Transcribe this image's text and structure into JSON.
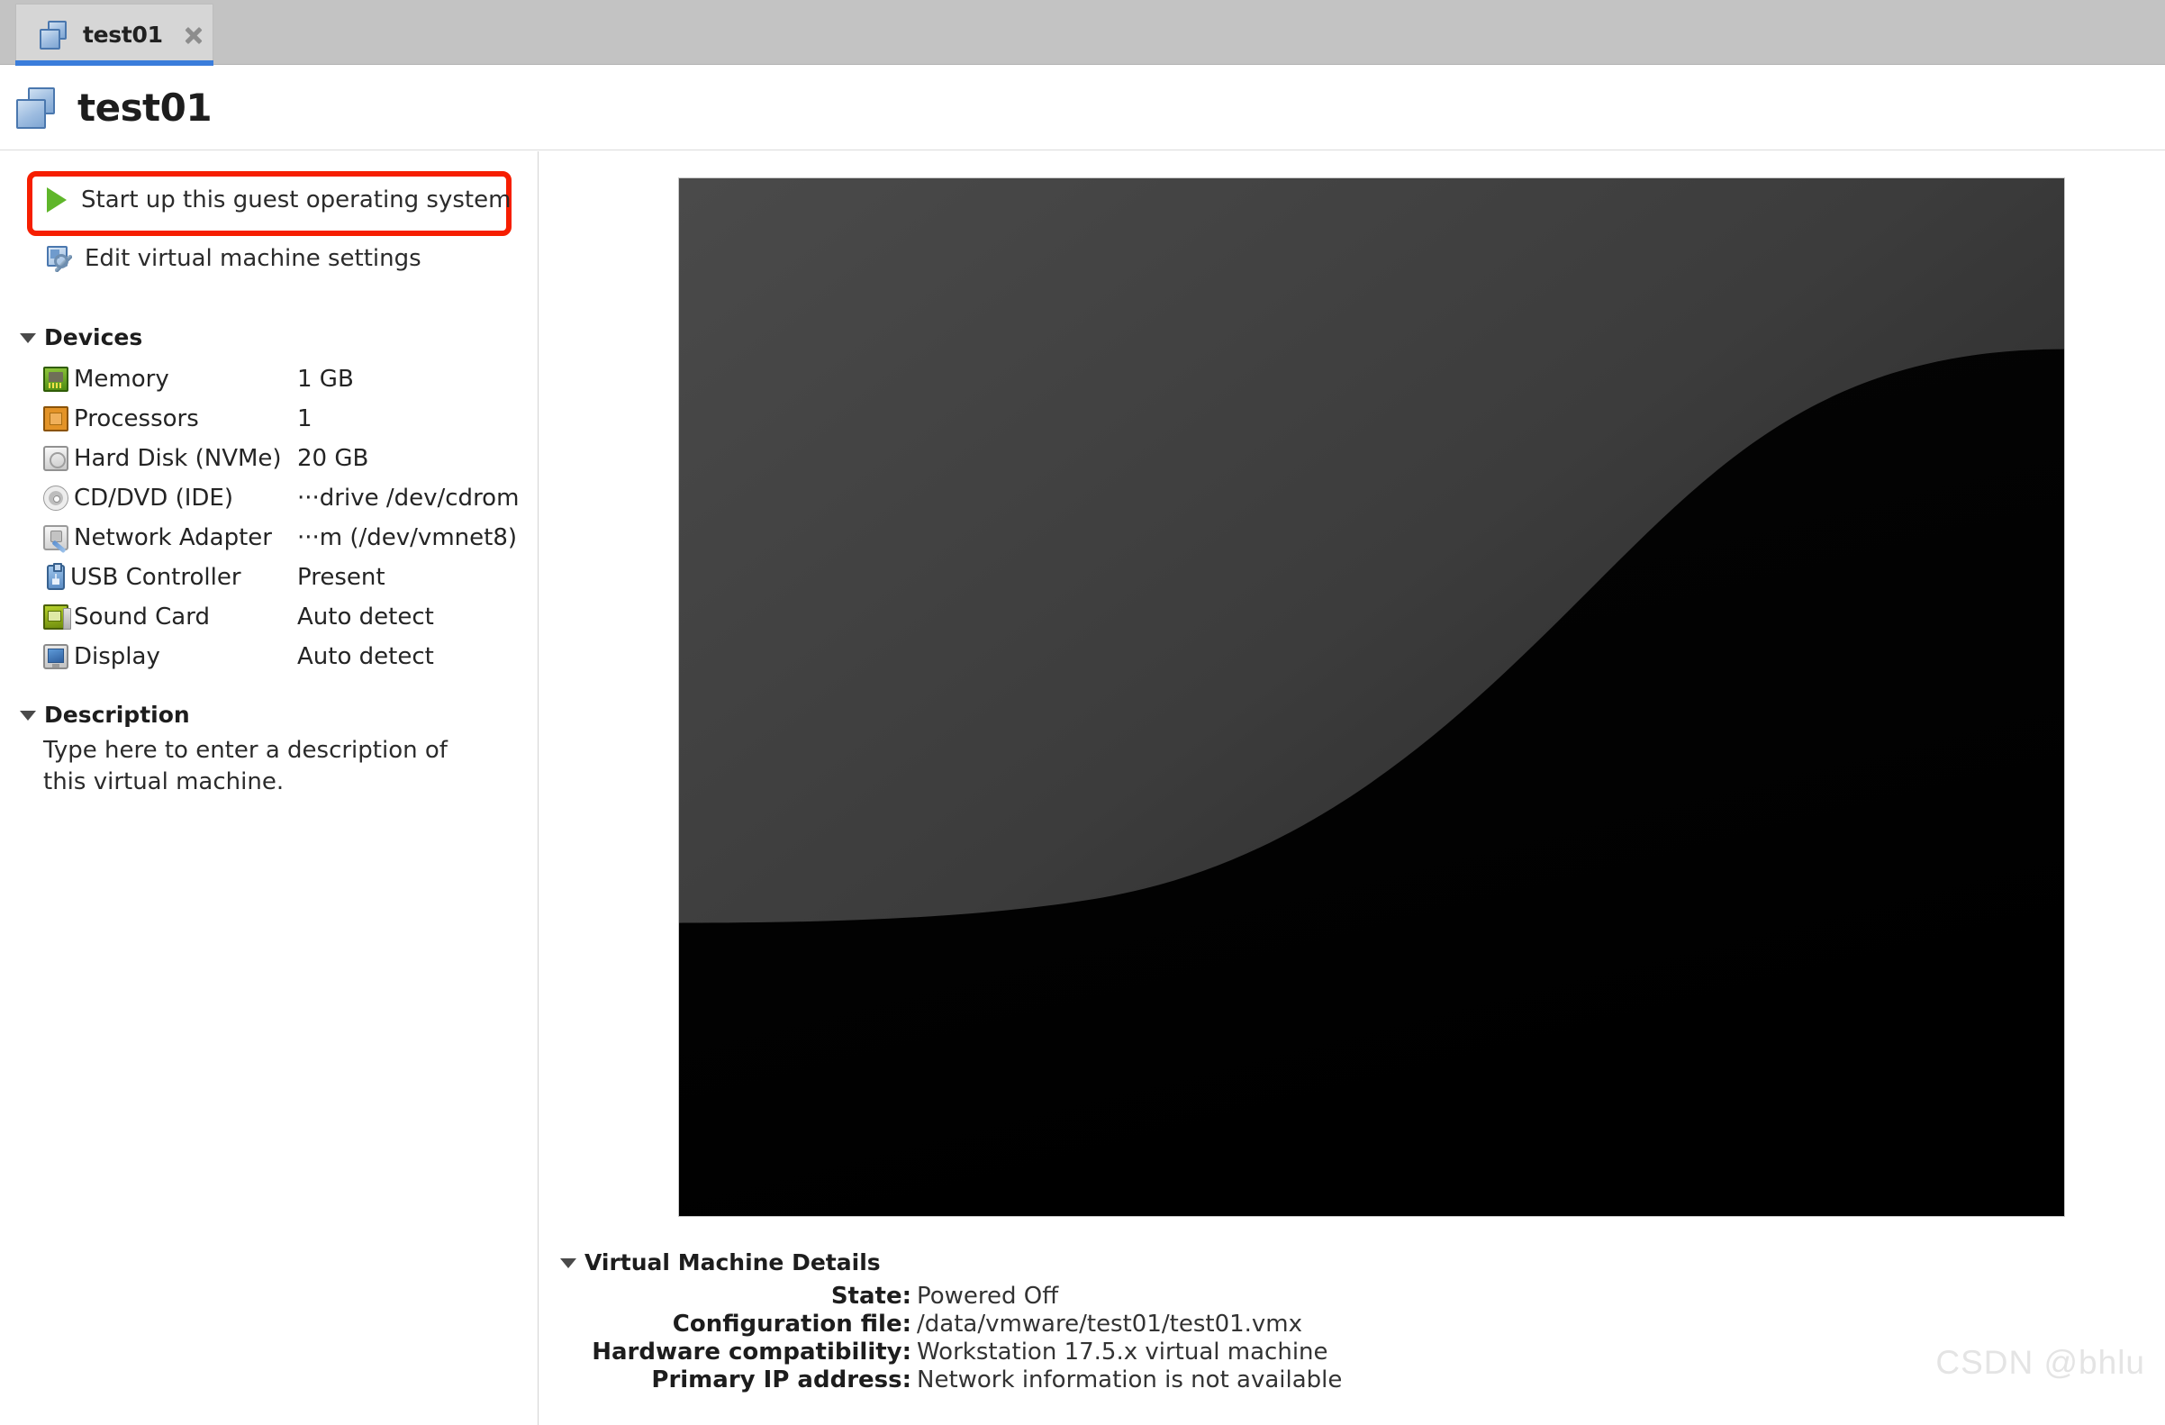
{
  "tab": {
    "label": "test01",
    "icon": "vm-stack-icon",
    "close_icon": "close-icon",
    "accent_color": "#3a7ddb",
    "bg_color": "#d6d6d6"
  },
  "header": {
    "title": "test01",
    "icon": "vm-stack-icon"
  },
  "sidebar": {
    "actions": [
      {
        "label": "Start up this guest operating system",
        "icon": "play-icon",
        "highlighted": true
      },
      {
        "label": "Edit virtual machine settings",
        "icon": "settings-icon",
        "highlighted": false
      }
    ],
    "highlight_color": "#f61e00",
    "devices_section": {
      "title": "Devices",
      "expanded": true,
      "rows": [
        {
          "name": "Memory",
          "value": "1 GB",
          "icon": "memory-chip-icon"
        },
        {
          "name": "Processors",
          "value": "1",
          "icon": "cpu-chip-icon"
        },
        {
          "name": "Hard Disk (NVMe)",
          "value": "20 GB",
          "icon": "hard-disk-icon"
        },
        {
          "name": "CD/DVD (IDE)",
          "value": "···drive /dev/cdrom",
          "icon": "cd-dvd-icon"
        },
        {
          "name": "Network Adapter",
          "value": "···m (/dev/vmnet8)",
          "icon": "network-adapter-icon"
        },
        {
          "name": "USB Controller",
          "value": "Present",
          "icon": "usb-icon"
        },
        {
          "name": "Sound Card",
          "value": "Auto detect",
          "icon": "sound-card-icon"
        },
        {
          "name": "Display",
          "value": "Auto detect",
          "icon": "display-icon"
        }
      ]
    },
    "description_section": {
      "title": "Description",
      "expanded": true,
      "placeholder": "Type here to enter a description of this virtual machine."
    }
  },
  "main": {
    "preview": {
      "name": "vm-screen-preview",
      "bg_top_color": "#414141",
      "bg_bottom_color": "#000000"
    },
    "details_section": {
      "title": "Virtual Machine Details",
      "expanded": true,
      "rows": [
        {
          "label": "State:",
          "value": "Powered Off"
        },
        {
          "label": "Configuration file:",
          "value": "/data/vmware/test01/test01.vmx"
        },
        {
          "label": "Hardware compatibility:",
          "value": "Workstation 17.5.x virtual machine"
        },
        {
          "label": "Primary IP address:",
          "value": "Network information is not available"
        }
      ]
    }
  },
  "watermark": {
    "text": "CSDN @bhlu"
  }
}
